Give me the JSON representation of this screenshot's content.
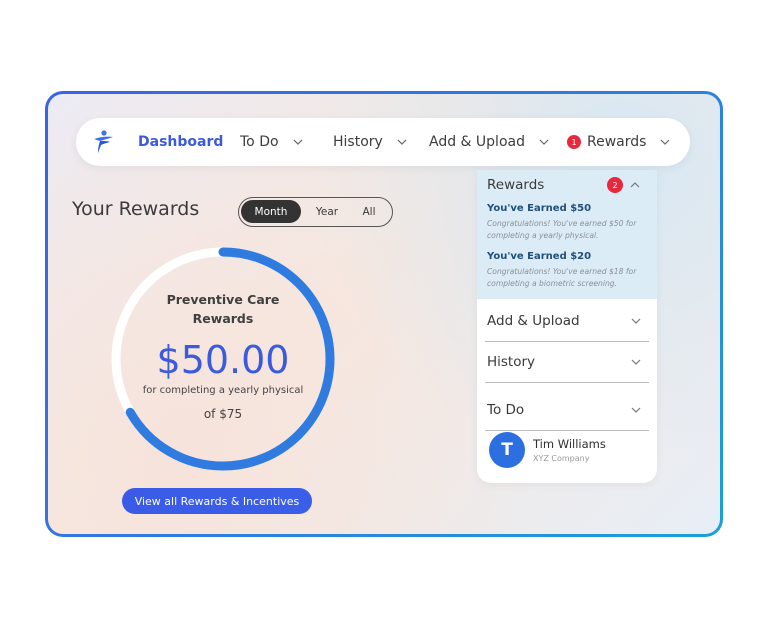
{
  "nav": {
    "items": [
      {
        "label": "Dashboard",
        "active": true
      },
      {
        "label": "To Do"
      },
      {
        "label": "History"
      },
      {
        "label": "Add & Upload"
      },
      {
        "label": "Rewards",
        "badge": "1"
      }
    ]
  },
  "rewards": {
    "heading": "Your Rewards",
    "periods": [
      "Month",
      "Year",
      "All"
    ],
    "selected_period": "Month",
    "ring": {
      "title_line1": "Preventive Care",
      "title_line2": "Rewards",
      "amount": "$50.00",
      "description": "for completing a yearly physical",
      "total": "of $75",
      "progress_fraction": 0.6667
    },
    "cta_label": "View all Rewards & Incentives"
  },
  "panel": {
    "rewards_label": "Rewards",
    "rewards_badge": "2",
    "earned": [
      {
        "title": "You've Earned $50",
        "text": "Congratulations! You've earned $50 for completing a yearly physical."
      },
      {
        "title": "You've Earned $20",
        "text": "Congratulations! You've earned $18 for completing a biometric screening."
      }
    ],
    "sections": [
      "Add & Upload",
      "History",
      "To Do"
    ],
    "user": {
      "initial": "T",
      "name": "Tim Williams",
      "company": "XYZ Company"
    }
  },
  "colors": {
    "accent": "#3b5bdb",
    "badge": "#e8283c",
    "ring_progress": "#2f7be0",
    "ring_track": "#ffffff",
    "frame_border": "#3a63e6"
  },
  "icons": {
    "logo": "person-figure-logo",
    "chevron": "chevron-down-icon",
    "chevron_up": "chevron-up-icon"
  }
}
